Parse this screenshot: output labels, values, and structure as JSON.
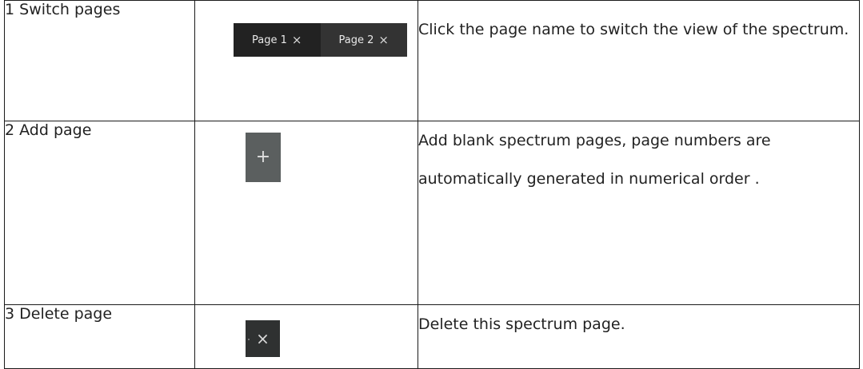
{
  "rows": [
    {
      "name": "1 Switch pages",
      "description": "Click the page name to switch the view of the spectrum."
    },
    {
      "name": "2 Add page",
      "description": "Add blank spectrum pages, page numbers are automatically generated in numerical order ."
    },
    {
      "name": "3 Delete page",
      "description": "Delete this spectrum page."
    }
  ],
  "tabs": [
    {
      "label": "Page 1",
      "close": "×"
    },
    {
      "label": "Page 2",
      "close": "×"
    }
  ],
  "add_button": {
    "symbol": "+"
  },
  "delete_button": {
    "symbol": "×"
  },
  "icons": [
    "close-icon",
    "plus-icon"
  ],
  "colors": {
    "tab_bar_bg": "#2b2b2b",
    "add_button_bg": "#5b5f5f",
    "delete_button_bg": "#2f3131"
  }
}
